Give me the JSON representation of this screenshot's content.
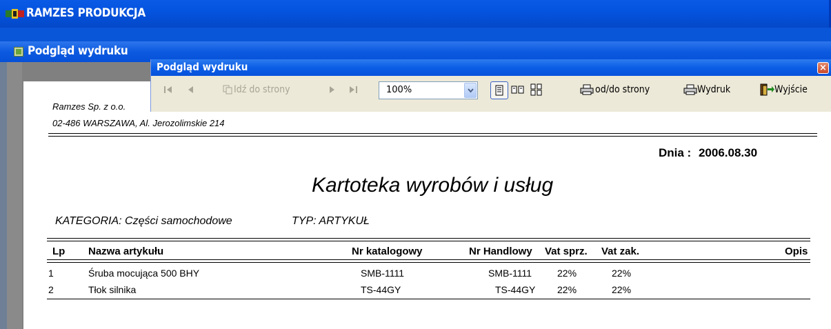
{
  "app": {
    "title": "RAMZES PRODUKCJA"
  },
  "mdi": {
    "title": "Podgląd wydruku"
  },
  "preview_window": {
    "title": "Podgląd wydruku",
    "toolbar": {
      "goto_page": "Idź do strony",
      "zoom": "100%",
      "page_range": "od/do strony",
      "print": "Wydruk",
      "exit": "Wyjście"
    }
  },
  "report": {
    "company": "Ramzes Sp. z o.o.",
    "address": "02-486 WARSZAWA, Al. Jerozolimskie 214",
    "date_label": "Dnia :",
    "date": "2006.08.30",
    "title": "Kartoteka wyrobów i usług",
    "category": "KATEGORIA: Części samochodowe",
    "type": "TYP: ARTYKUŁ",
    "columns": [
      "Lp",
      "Nazwa artykułu",
      "Nr katalogowy",
      "Nr Handlowy",
      "Vat sprz.",
      "Vat zak.",
      "Opis"
    ],
    "rows": [
      {
        "lp": "1",
        "name": "Śruba mocująca 500 BHY",
        "catalog": "SMB-1111",
        "trade": "SMB-1111",
        "vat_s": "22%",
        "vat_z": "22%",
        "desc": ""
      },
      {
        "lp": "2",
        "name": "Tłok silnika",
        "catalog": "TS-44GY",
        "trade": "TS-44GY",
        "vat_s": "22%",
        "vat_z": "22%",
        "desc": ""
      }
    ]
  }
}
